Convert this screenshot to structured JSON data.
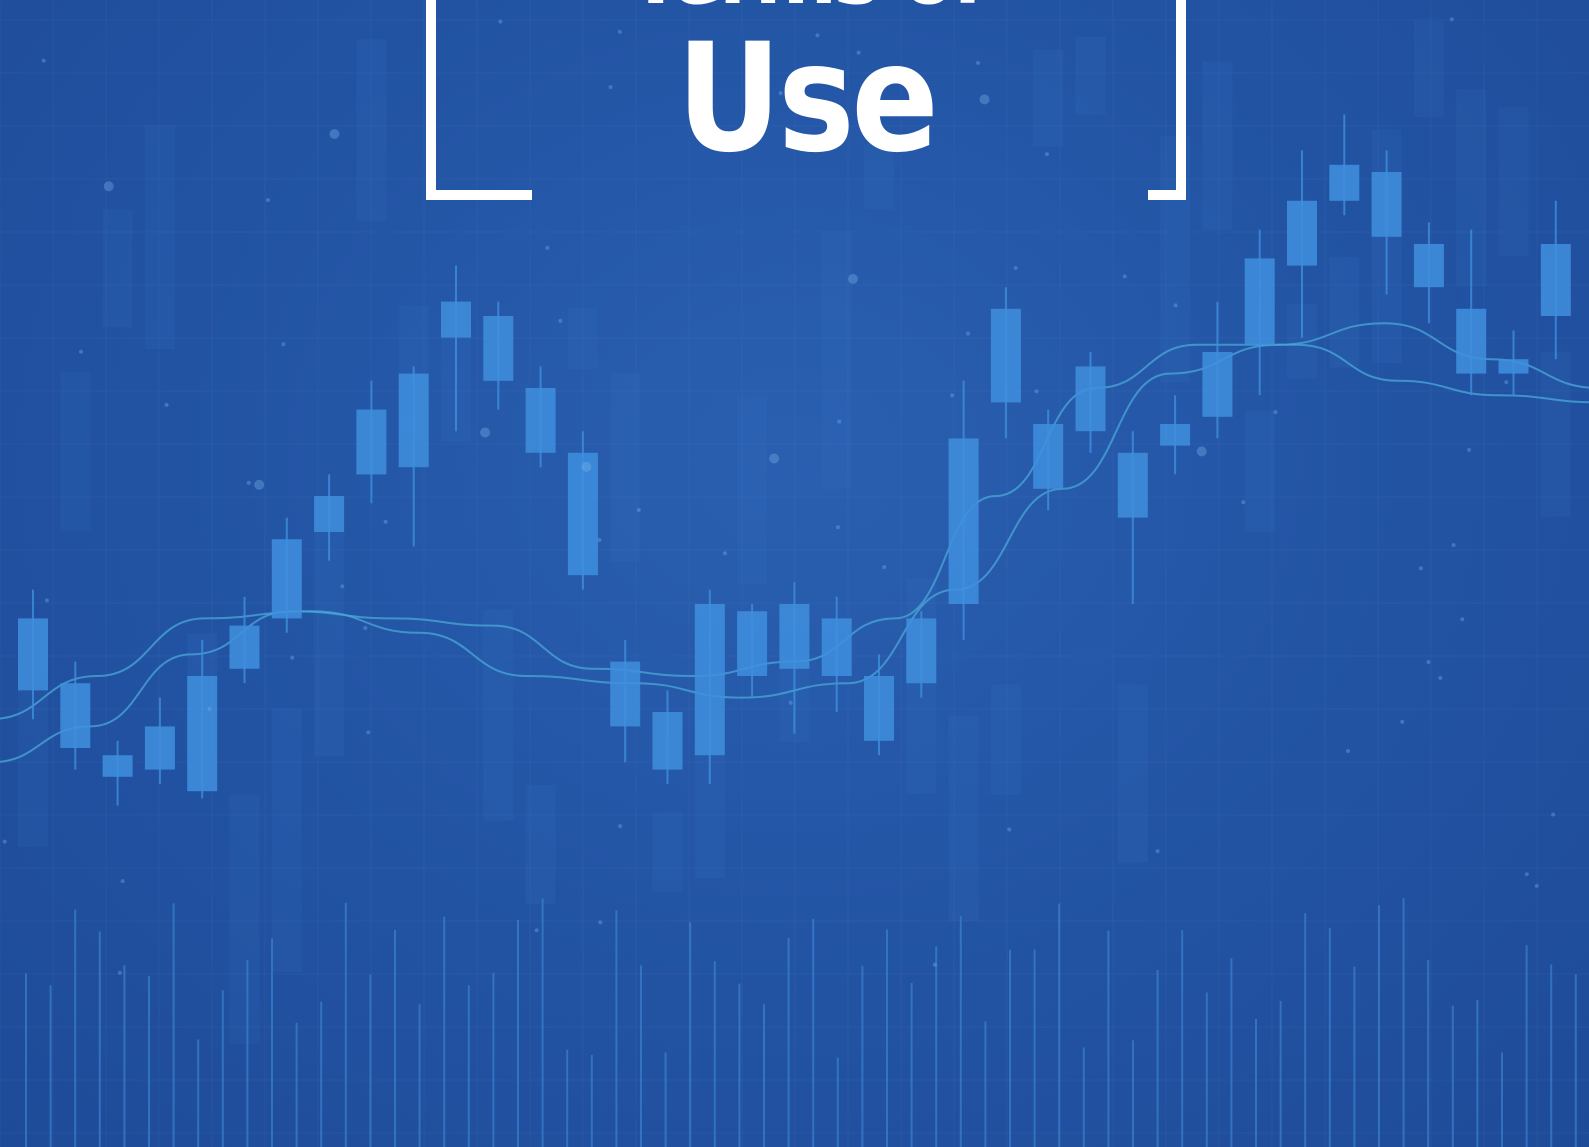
{
  "hero": {
    "title_line_1": "Terms of",
    "title_line_2": "Use"
  },
  "colors": {
    "background": "#21519f",
    "candle": "#3f8fde",
    "candle_faint": "#3a78c8",
    "moving_average": "#4aa8d8",
    "title_text": "#ffffff"
  },
  "background_graphic": {
    "type": "candlestick",
    "decorative": true,
    "candles": [
      {
        "open": 68,
        "close": 78,
        "high": 82,
        "low": 64
      },
      {
        "open": 69,
        "close": 60,
        "high": 72,
        "low": 57
      },
      {
        "open": 59,
        "close": 56,
        "high": 61,
        "low": 52
      },
      {
        "open": 57,
        "close": 63,
        "high": 67,
        "low": 55
      },
      {
        "open": 54,
        "close": 70,
        "high": 75,
        "low": 53
      },
      {
        "open": 71,
        "close": 77,
        "high": 81,
        "low": 69
      },
      {
        "open": 78,
        "close": 89,
        "high": 92,
        "low": 76
      },
      {
        "open": 90,
        "close": 95,
        "high": 98,
        "low": 86
      },
      {
        "open": 98,
        "close": 107,
        "high": 111,
        "low": 94
      },
      {
        "open": 112,
        "close": 99,
        "high": 113,
        "low": 88
      },
      {
        "open": 117,
        "close": 122,
        "high": 127,
        "low": 104
      },
      {
        "open": 120,
        "close": 111,
        "high": 122,
        "low": 107
      },
      {
        "open": 110,
        "close": 101,
        "high": 113,
        "low": 99
      },
      {
        "open": 101,
        "close": 84,
        "high": 104,
        "low": 82
      },
      {
        "open": 72,
        "close": 63,
        "high": 75,
        "low": 58
      },
      {
        "open": 65,
        "close": 57,
        "high": 68,
        "low": 55
      },
      {
        "open": 59,
        "close": 80,
        "high": 82,
        "low": 55
      },
      {
        "open": 79,
        "close": 70,
        "high": 80,
        "low": 67
      },
      {
        "open": 71,
        "close": 80,
        "high": 83,
        "low": 62
      },
      {
        "open": 78,
        "close": 70,
        "high": 81,
        "low": 65
      },
      {
        "open": 61,
        "close": 70,
        "high": 73,
        "low": 59
      },
      {
        "open": 69,
        "close": 78,
        "high": 79,
        "low": 67
      },
      {
        "open": 80,
        "close": 103,
        "high": 111,
        "low": 75
      },
      {
        "open": 108,
        "close": 121,
        "high": 124,
        "low": 103
      },
      {
        "open": 96,
        "close": 105,
        "high": 107,
        "low": 93
      },
      {
        "open": 104,
        "close": 113,
        "high": 115,
        "low": 101
      },
      {
        "open": 92,
        "close": 101,
        "high": 104,
        "low": 80
      },
      {
        "open": 102,
        "close": 105,
        "high": 109,
        "low": 98
      },
      {
        "open": 106,
        "close": 115,
        "high": 122,
        "low": 103
      },
      {
        "open": 116,
        "close": 128,
        "high": 132,
        "low": 109
      },
      {
        "open": 127,
        "close": 136,
        "high": 143,
        "low": 117
      },
      {
        "open": 136,
        "close": 141,
        "high": 148,
        "low": 134
      },
      {
        "open": 140,
        "close": 131,
        "high": 143,
        "low": 123
      },
      {
        "open": 130,
        "close": 124,
        "high": 133,
        "low": 119
      },
      {
        "open": 121,
        "close": 112,
        "high": 132,
        "low": 109
      },
      {
        "open": 112,
        "close": 114,
        "high": 118,
        "low": 109
      },
      {
        "open": 120,
        "close": 130,
        "high": 136,
        "low": 114
      }
    ],
    "moving_average_fast": [
      58,
      63,
      73,
      79,
      78,
      77,
      71,
      70,
      72,
      78,
      95,
      110,
      116,
      116,
      111,
      109,
      108
    ],
    "moving_average_slow": [
      64,
      70,
      78,
      79,
      76,
      70,
      69,
      67,
      69,
      82,
      96,
      112,
      116,
      119,
      114,
      110
    ]
  }
}
